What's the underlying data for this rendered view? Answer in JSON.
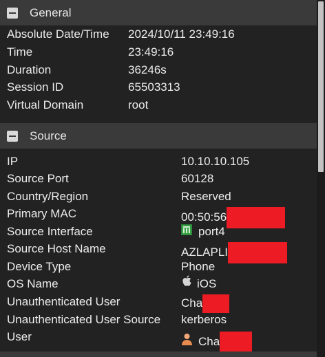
{
  "general": {
    "title": "General",
    "rows": [
      {
        "label": "Absolute Date/Time",
        "value": "2024/10/11 23:49:16"
      },
      {
        "label": "Time",
        "value": "23:49:16"
      },
      {
        "label": "Duration",
        "value": "36246s"
      },
      {
        "label": "Session ID",
        "value": "65503313"
      },
      {
        "label": "Virtual Domain",
        "value": "root"
      }
    ]
  },
  "source": {
    "title": "Source",
    "rows": [
      {
        "label": "IP",
        "value": "10.10.10.105"
      },
      {
        "label": "Source Port",
        "value": "60128"
      },
      {
        "label": "Country/Region",
        "value": "Reserved"
      },
      {
        "label": "Primary MAC",
        "value": "00:50:56"
      },
      {
        "label": "Source Interface",
        "value": "port4"
      },
      {
        "label": "Source Host Name",
        "value": "AZLAPLI"
      },
      {
        "label": "Device Type",
        "value": "Phone"
      },
      {
        "label": "OS Name",
        "value": "iOS"
      },
      {
        "label": "Unauthenticated User",
        "value": "Cha"
      },
      {
        "label": "Unauthenticated User Source",
        "value": "kerberos"
      },
      {
        "label": "User",
        "value": "Cha"
      }
    ]
  },
  "icons": {
    "collapse": "minus-square-icon",
    "interface": "network-port-icon",
    "os": "apple-icon",
    "user": "user-icon"
  },
  "colors": {
    "background": "#222222",
    "header_background": "#3a3a3a",
    "text": "#ececec",
    "redaction": "#ed1c24",
    "port_icon": "#35a345"
  }
}
